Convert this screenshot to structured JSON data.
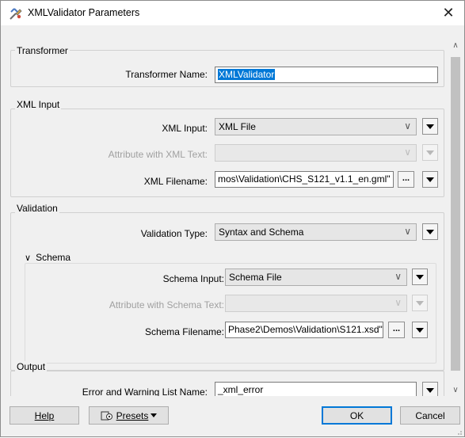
{
  "window": {
    "title": "XMLValidator Parameters",
    "close_glyph": "✕"
  },
  "transformer_group": {
    "title": "Transformer",
    "name_label": "Transformer Name:",
    "name_value": "XMLValidator"
  },
  "xml_input_group": {
    "title": "XML Input",
    "input_label": "XML Input:",
    "input_value": "XML File",
    "attr_label": "Attribute with XML Text:",
    "attr_value": "",
    "filename_label": "XML Filename:",
    "filename_value": "mos\\Validation\\CHS_S121_v1.1_en.gml\"",
    "browse_label": "..."
  },
  "validation_group": {
    "title": "Validation",
    "type_label": "Validation Type:",
    "type_value": "Syntax and Schema",
    "schema": {
      "toggle_glyph": "∨",
      "title": "Schema",
      "input_label": "Schema Input:",
      "input_value": "Schema File",
      "attr_label": "Attribute with Schema Text:",
      "attr_value": "",
      "filename_label": "Schema Filename:",
      "filename_value": "Phase2\\Demos\\Validation\\S121.xsd\"",
      "browse_label": "..."
    }
  },
  "output_group": {
    "title": "Output",
    "list_label": "Error and Warning List Name:",
    "list_value": "_xml_error"
  },
  "footer": {
    "help_label": "Help",
    "presets_label": "Presets",
    "ok_label": "OK",
    "cancel_label": "Cancel"
  },
  "icons": {
    "title": "transformer-icon",
    "dropdown": "chevron-down-icon",
    "menu": "triangle-down-icon",
    "presets": "presets-icon"
  },
  "colors": {
    "selection": "#0078d7",
    "dialog_bg": "#f0f0f0"
  }
}
